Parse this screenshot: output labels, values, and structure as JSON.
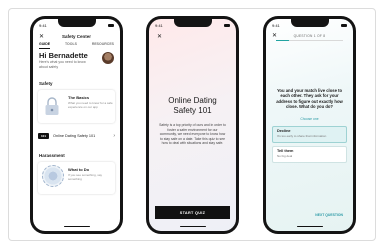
{
  "status": {
    "time": "9:41"
  },
  "phone1": {
    "title": "Safety Center",
    "tabs": [
      "GUIDE",
      "TOOLS",
      "RESOURCES"
    ],
    "greeting": "Hi Bernadette",
    "greeting_sub": "Here's what you need to know about safety",
    "section_safety": "Safety",
    "card1_title": "The Basics",
    "card1_desc": "What you need to know for a safe experience on our app",
    "row_badge": "101",
    "row_label": "Online Dating Safety 101",
    "section_harassment": "Harassment",
    "card2_title": "What to Do",
    "card2_desc": "If you see something, say something"
  },
  "phone2": {
    "title_line1": "Online Dating",
    "title_line2": "Safety 101",
    "body": "Safety is a top priority of ours and in order to foster a safer environment for our community, we need everyone to know how to stay safe on a date. Take this quiz to see how to deal with situations and stay safe.",
    "button": "START QUIZ"
  },
  "phone3": {
    "counter": "QUESTION 1 OF 8",
    "progress": 0.2,
    "question": "You and your match live close to each other. They ask for your address to figure out exactly how close. What do you do?",
    "choose": "Choose one",
    "options": [
      {
        "title": "Decline",
        "desc": "It's too early to share that information"
      },
      {
        "title": "Tell them",
        "desc": "No big deal"
      }
    ],
    "next": "NEXT QUESTION"
  }
}
